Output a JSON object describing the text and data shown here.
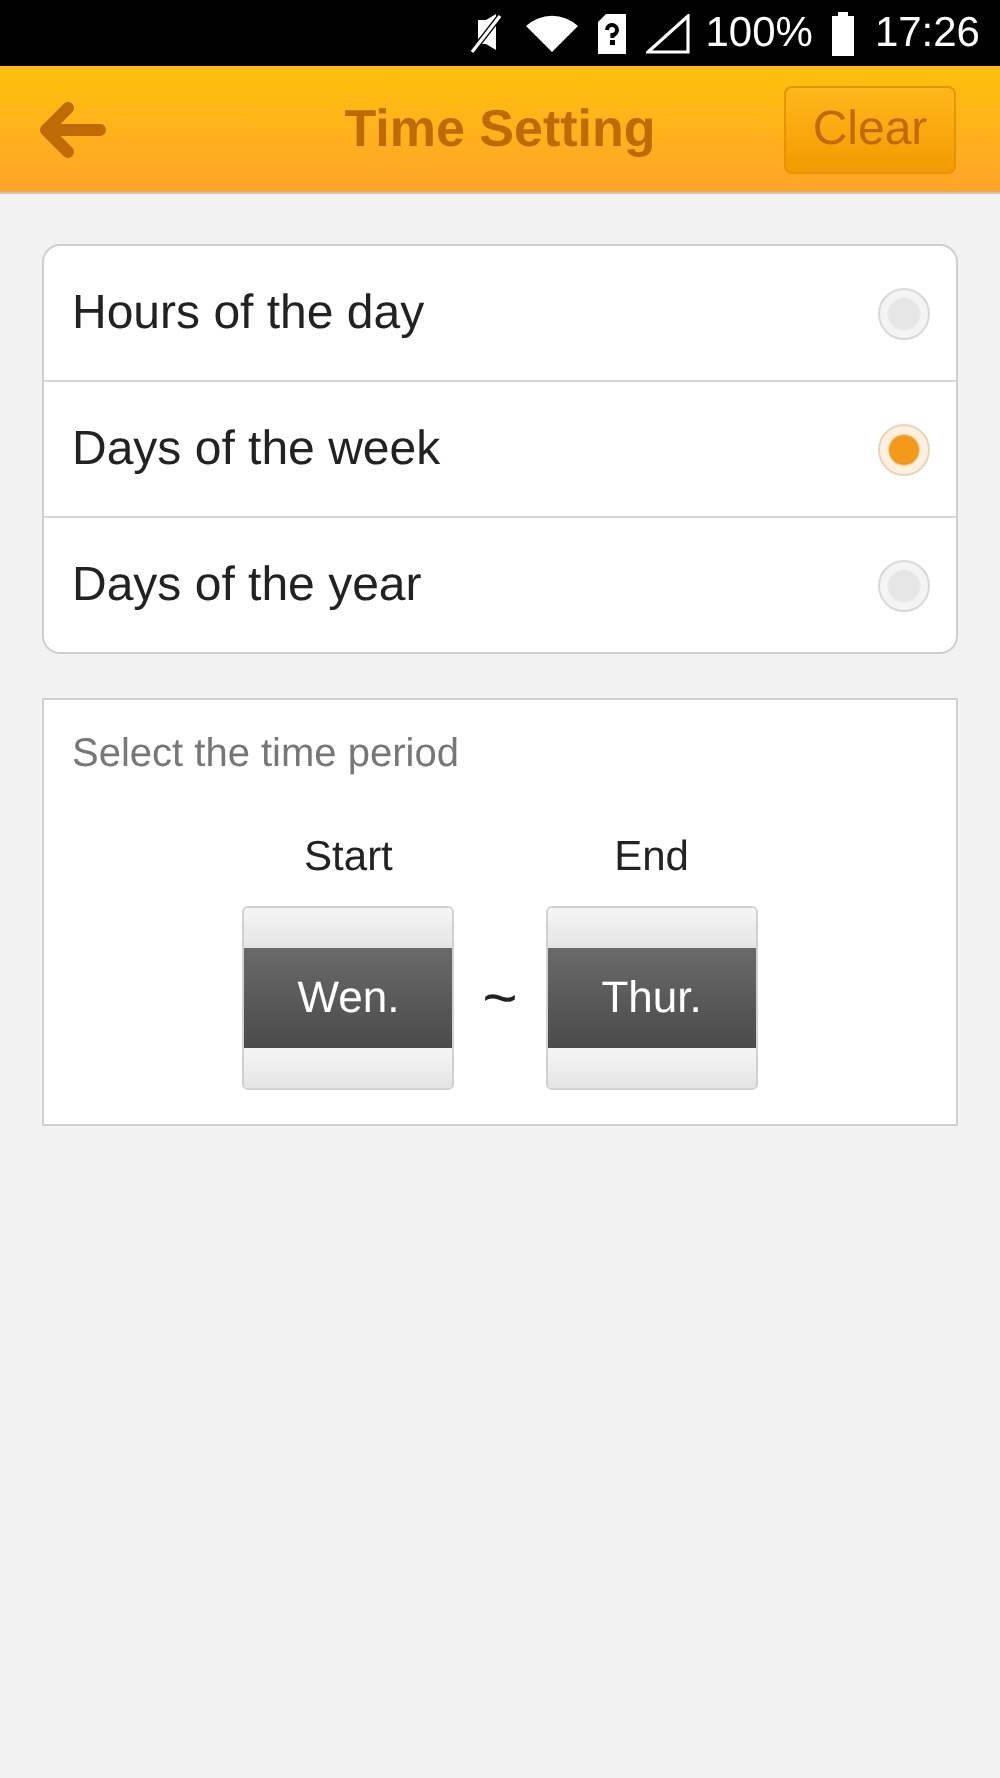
{
  "status_bar": {
    "battery": "100%",
    "time": "17:26"
  },
  "header": {
    "title": "Time Setting",
    "action": "Clear"
  },
  "options": [
    {
      "label": "Hours of the day",
      "selected": false
    },
    {
      "label": "Days of the week",
      "selected": true
    },
    {
      "label": "Days of the year",
      "selected": false
    }
  ],
  "period": {
    "prompt": "Select the time period",
    "separator": "~",
    "pickers": [
      {
        "label": "Start",
        "value": "Wen."
      },
      {
        "label": "End",
        "value": "Thur."
      }
    ]
  }
}
